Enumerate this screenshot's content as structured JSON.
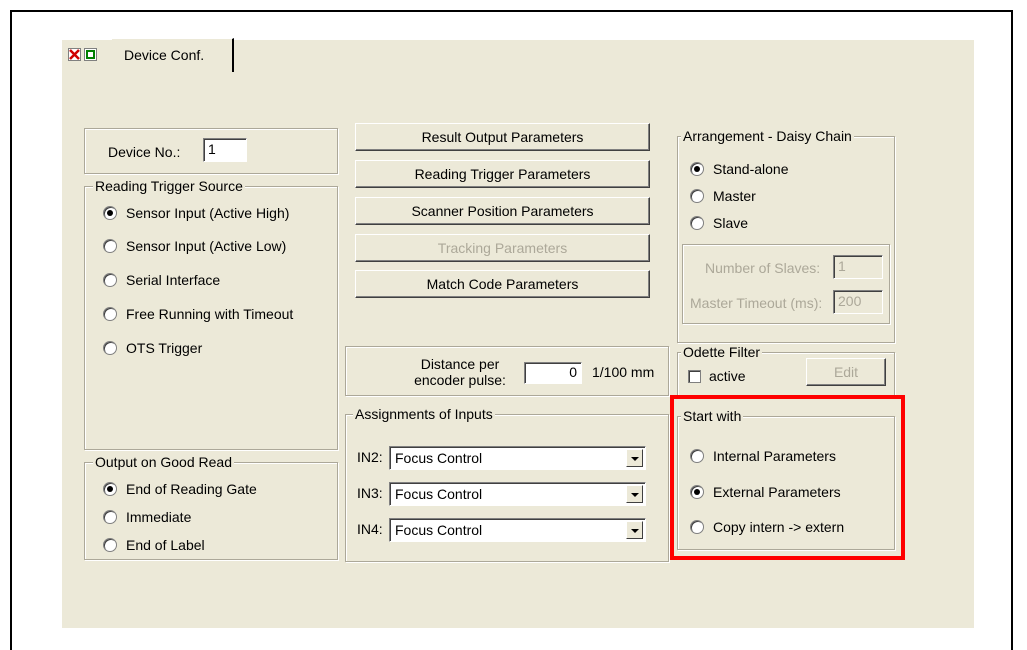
{
  "tab": {
    "label": "Device Conf."
  },
  "device": {
    "label": "Device No.:",
    "value": "1"
  },
  "reading_trigger": {
    "title": "Reading Trigger Source",
    "options": [
      "Sensor Input (Active High)",
      "Sensor Input (Active Low)",
      "Serial Interface",
      "Free Running with Timeout",
      "OTS Trigger"
    ],
    "selected": "Sensor Input (Active High)"
  },
  "output_good_read": {
    "title": "Output on Good Read",
    "options": [
      "End of Reading Gate",
      "Immediate",
      "End of Label"
    ],
    "selected": "End of Reading Gate"
  },
  "buttons": {
    "result_output": "Result Output Parameters",
    "reading_trigger": "Reading Trigger Parameters",
    "scanner_position": "Scanner Position Parameters",
    "tracking": "Tracking Parameters",
    "match_code": "Match Code Parameters"
  },
  "encoder": {
    "label_line1": "Distance per",
    "label_line2": "encoder pulse:",
    "value": "0",
    "unit": "1/100 mm"
  },
  "inputs": {
    "title": "Assignments of Inputs",
    "rows": [
      {
        "label": "IN2:",
        "value": "Focus Control"
      },
      {
        "label": "IN3:",
        "value": "Focus Control"
      },
      {
        "label": "IN4:",
        "value": "Focus Control"
      }
    ]
  },
  "daisy_chain": {
    "title": "Arrangement - Daisy Chain",
    "options": [
      "Stand-alone",
      "Master",
      "Slave"
    ],
    "selected": "Stand-alone",
    "slaves_label": "Number of Slaves:",
    "slaves_value": "1",
    "timeout_label": "Master Timeout (ms):",
    "timeout_value": "200"
  },
  "odette": {
    "title": "Odette Filter",
    "active_label": "active",
    "edit_label": "Edit"
  },
  "start_with": {
    "title": "Start with",
    "options": [
      "Internal Parameters",
      "External Parameters",
      "Copy intern -> extern"
    ],
    "selected": "External Parameters"
  },
  "colors": {
    "highlight": "#ff0000",
    "panel": "#ece9d8"
  },
  "icons": {
    "close": "close-icon",
    "restore": "restore-icon"
  }
}
